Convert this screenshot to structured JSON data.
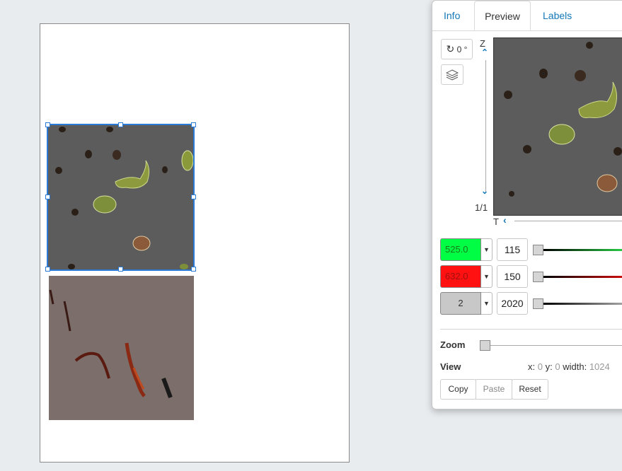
{
  "dialog": {
    "tabs": [
      {
        "label": "Info"
      },
      {
        "label": "Preview"
      },
      {
        "label": "Labels"
      }
    ],
    "rotate_label": "0 °",
    "z_label": "Z",
    "z_index": "1/1",
    "t_label": "T",
    "channels": [
      {
        "label": "525.0",
        "color": "#00ff44",
        "text_color": "#1a7a1a",
        "value": "115"
      },
      {
        "label": "632.0",
        "color": "#ff1111",
        "text_color": "#a01010",
        "value": "150"
      },
      {
        "label": "2",
        "color": "#c8c8c8",
        "text_color": "#333333",
        "value": "2020"
      }
    ],
    "zoom_label": "Zoom",
    "view_label": "View",
    "view_info": {
      "x_label": "x:",
      "x": "0",
      "y_label": "y:",
      "y": "0",
      "width_label": "width:",
      "width": "1024"
    },
    "buttons": {
      "copy": "Copy",
      "paste": "Paste",
      "reset": "Reset"
    }
  }
}
